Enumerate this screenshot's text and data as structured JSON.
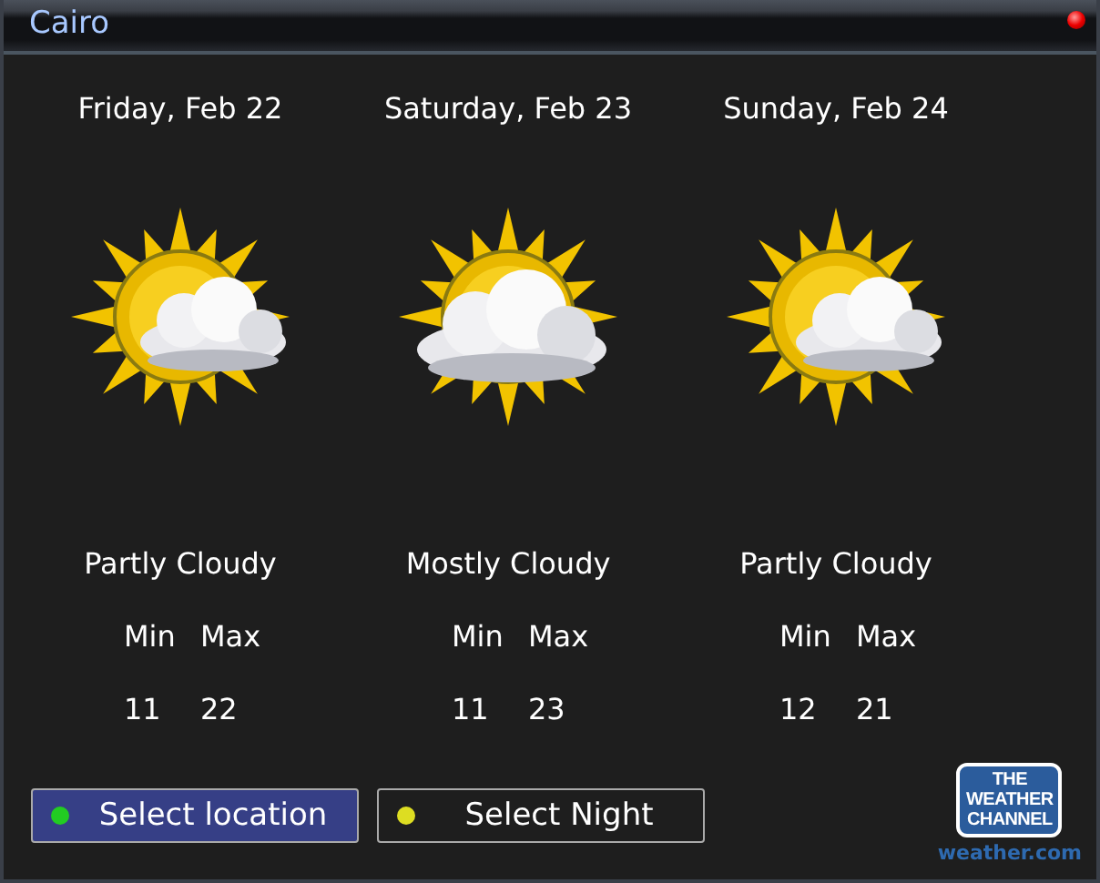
{
  "window": {
    "title": "Cairo"
  },
  "days": [
    {
      "date": "Friday, Feb 22",
      "kind": "partly",
      "condition": "Partly Cloudy",
      "min_label": "Min",
      "max_label": "Max",
      "min": "11",
      "max": "22"
    },
    {
      "date": "Saturday, Feb 23",
      "kind": "mostly",
      "condition": "Mostly Cloudy",
      "min_label": "Min",
      "max_label": "Max",
      "min": "11",
      "max": "23"
    },
    {
      "date": "Sunday, Feb 24",
      "kind": "partly",
      "condition": "Partly Cloudy",
      "min_label": "Min",
      "max_label": "Max",
      "min": "12",
      "max": "21"
    }
  ],
  "buttons": [
    {
      "label": "Select location",
      "selected": true,
      "color": "#22cc22"
    },
    {
      "label": "Select Night",
      "selected": false,
      "color": "#dddd22"
    }
  ],
  "logo": {
    "lines": [
      "THE",
      "WEATHER",
      "CHANNEL"
    ],
    "site": "weather.com"
  }
}
